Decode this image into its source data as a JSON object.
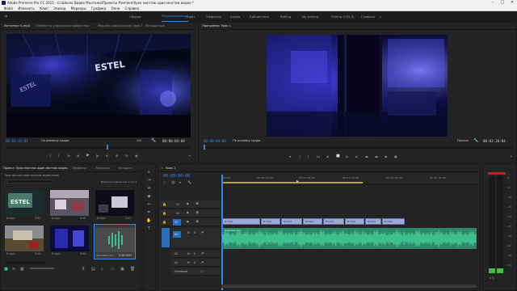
{
  "titlebar": {
    "title": "Adobe Premiere Pro CC 2015 - G:\\Школа Видео Монтажа\\Проекты Premiere\\Урок монтаж один монтаж видео *"
  },
  "menu": [
    "Файл",
    "Изменить",
    "Клип",
    "Эпизод",
    "Маркеры",
    "Графика",
    "Окно",
    "Справка"
  ],
  "workspaces": [
    {
      "label": "Сборка",
      "active": false
    },
    {
      "label": "Редактирование",
      "active": true
    },
    {
      "label": "Цвет",
      "active": false
    },
    {
      "label": "Эффекты",
      "active": false
    },
    {
      "label": "Аудио",
      "active": false
    },
    {
      "label": "Библиотеки",
      "active": false
    },
    {
      "label": "Editing",
      "active": false
    },
    {
      "label": "My editing",
      "active": false
    },
    {
      "label": "Editing (CS5.5)",
      "active": false
    },
    {
      "label": "Графика",
      "active": false
    }
  ],
  "source": {
    "tabs": [
      "Источник: Б.mp4",
      "Элементы управления эффектами",
      "Микшер аудиоклипов: Урок 1",
      "Метаданные"
    ],
    "timecode": "00:01:32:01",
    "fit": "По размеру кадра",
    "fraction": "1/4",
    "duration": "00:00:04:09",
    "neon_text": "ESTEL",
    "playhead_frac": 0.55
  },
  "program": {
    "tabs": [
      "Программа: Урок 1"
    ],
    "timecode": "00:00:00:00",
    "fit": "По размеру кадра",
    "quality": "Полное",
    "duration": "00:02:20:04"
  },
  "project": {
    "tabs": [
      "Проект: Урок монтаж один монтаж видео",
      "Эффекты",
      "Маркеры",
      "История"
    ],
    "path": "Урок монтаж один монтаж видео.prproj",
    "selection": "Выбрано элементов: 1 из 11",
    "items": [
      {
        "name": "Б.mp4",
        "dur": "3:01"
      },
      {
        "name": "Б.mp4",
        "dur": "4:18"
      },
      {
        "name": "Б.mp4",
        "dur": "3:21"
      },
      {
        "name": "Б.mp4",
        "dur": "3:19"
      },
      {
        "name": "Б.mp4",
        "dur": "4:09"
      },
      {
        "name": "Фоновая муз.",
        "dur": "2:18:0000"
      }
    ]
  },
  "timeline": {
    "tab": "Урок 1",
    "timecode": "00:00:00:00",
    "ruler": [
      "00:00",
      "00:00:30:00",
      "00:01:00:00",
      "00:01:30:00",
      "00:02:00:00",
      "00:02:30:00"
    ],
    "tracks_v": [
      "V3",
      "V2",
      "V1"
    ],
    "tracks_a": [
      "A1",
      "A2",
      "A3"
    ],
    "master": "Основной",
    "master_val": "0,0",
    "clip_labels": [
      "Б.mp4",
      "Б.mp4",
      "Б.mp4",
      "Б.mp4",
      "Б.mp4",
      "Б.mp4",
      "Б.mp4",
      "Б.mp4"
    ],
    "audio_clip": "Фоновая муз."
  },
  "meter": {
    "scale": [
      "0",
      "-6",
      "-12",
      "-18",
      "-24",
      "-30",
      "-36",
      "-42",
      "-48",
      "-54"
    ],
    "label": "S S"
  },
  "colors": {
    "accent": "#2d8ceb",
    "video_clip": "#9fa8d8",
    "audio_clip": "#3fbf8f"
  }
}
